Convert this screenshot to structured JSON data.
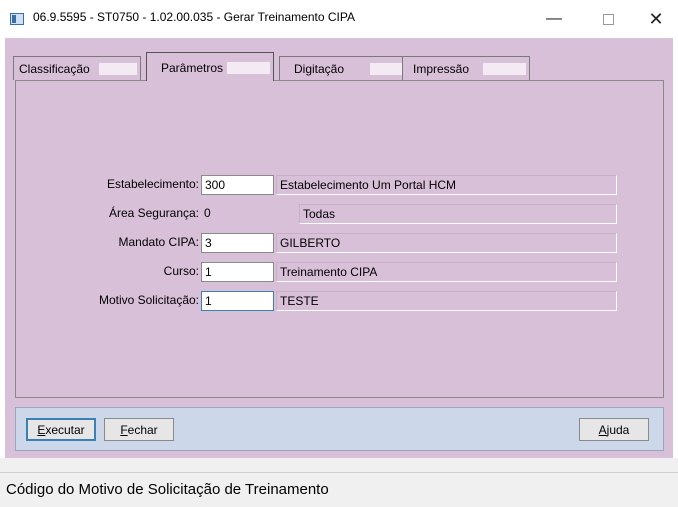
{
  "window": {
    "title": "06.9.5595 - ST0750 - 1.02.00.035 - Gerar Treinamento CIPA",
    "minimize_glyph": "—",
    "close_glyph": "✕"
  },
  "tabs": [
    {
      "label": "Classificação",
      "active": false
    },
    {
      "label": "Parâmetros",
      "active": true
    },
    {
      "label": "Digitação",
      "active": false
    },
    {
      "label": "Impressão",
      "active": false
    }
  ],
  "form": {
    "estabelecimento": {
      "label": "Estabelecimento:",
      "value": "300",
      "description": "Estabelecimento Um Portal HCM"
    },
    "area_seguranca": {
      "label": "Área Segurança:",
      "value": "0",
      "description": "Todas"
    },
    "mandato_cipa": {
      "label": "Mandato CIPA:",
      "value": "3",
      "description": "GILBERTO"
    },
    "curso": {
      "label": "Curso:",
      "value": "1",
      "description": "Treinamento CIPA"
    },
    "motivo_solicitacao": {
      "label": "Motivo Solicitação:",
      "value": "1",
      "description": "TESTE"
    }
  },
  "buttons": {
    "executar": {
      "mnemonic": "E",
      "rest": "xecutar"
    },
    "fechar": {
      "mnemonic": "F",
      "rest": "echar"
    },
    "ajuda": {
      "mnemonic": "A",
      "rest": "juda"
    }
  },
  "status": {
    "text": "Código do Motivo de Solicitação de Treinamento"
  }
}
